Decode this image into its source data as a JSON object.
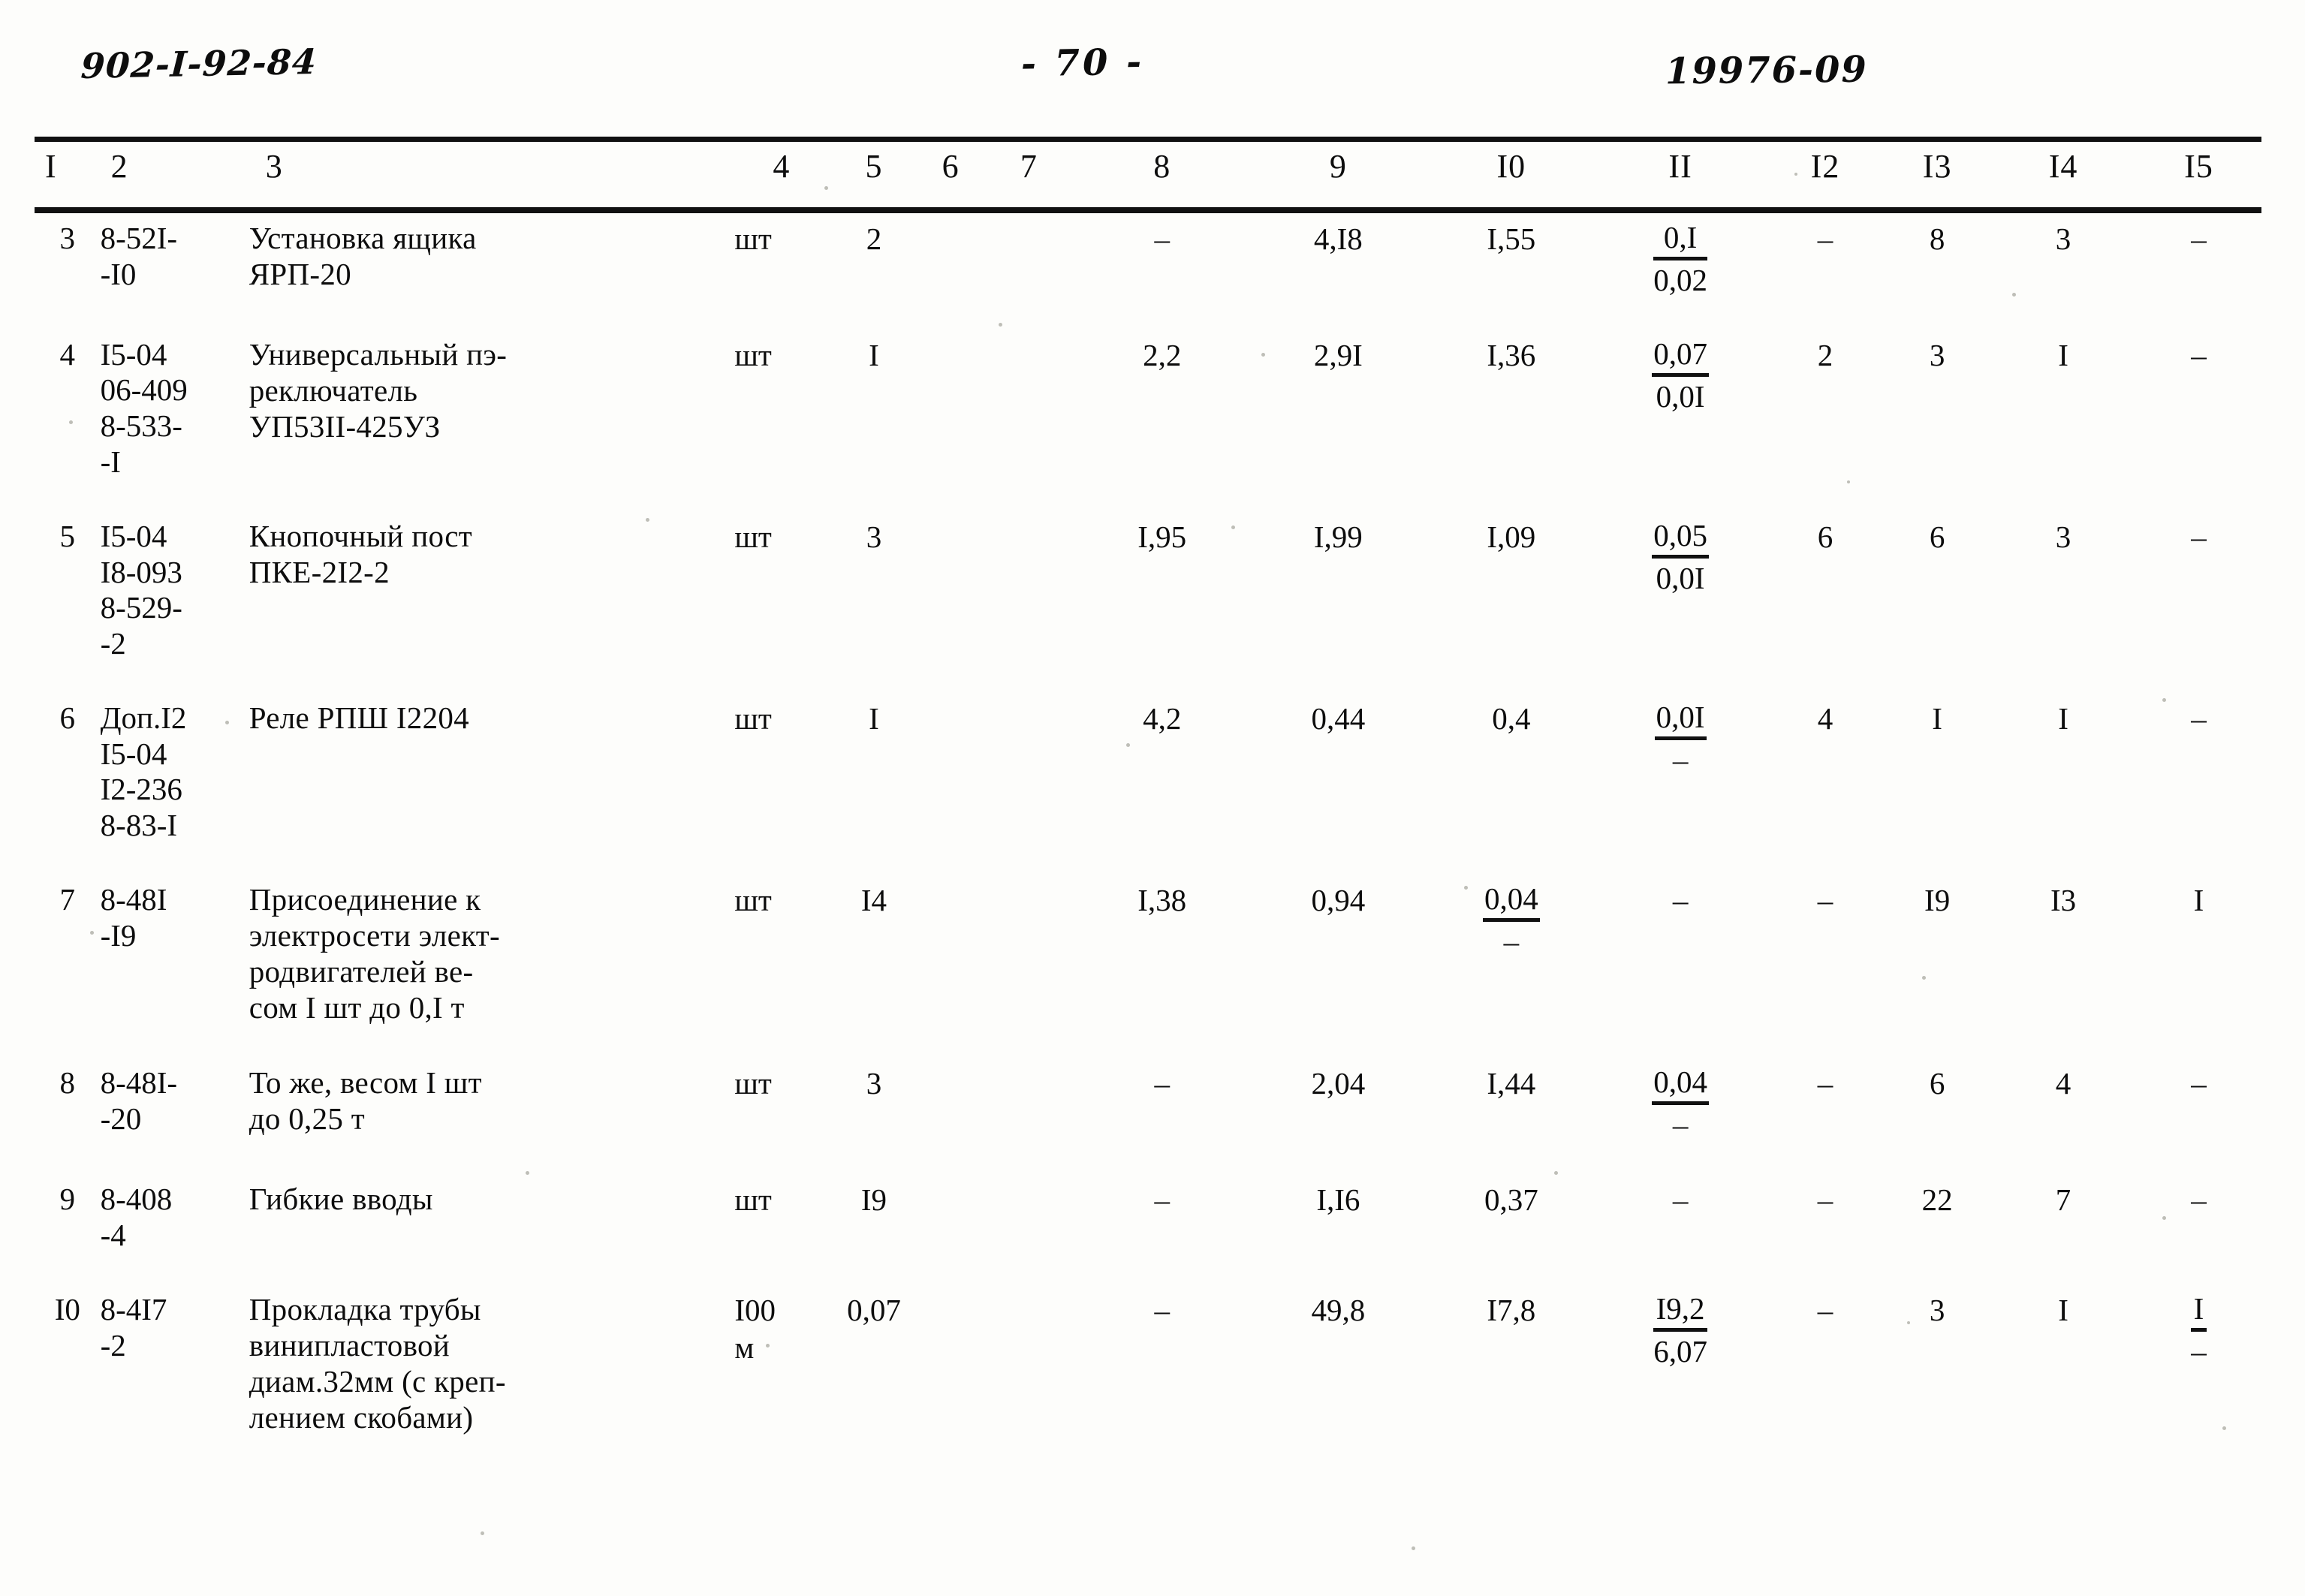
{
  "header": {
    "doc_code": "902-I-92-84",
    "page_marker": "- 70 -",
    "sheet_code": "19976-09"
  },
  "table": {
    "column_numbers": [
      "I",
      "2",
      "3",
      "4",
      "5",
      "6",
      "7",
      "8",
      "9",
      "I0",
      "II",
      "I2",
      "I3",
      "I4",
      "I5"
    ],
    "rows": [
      {
        "pos": "3",
        "code": "8-52I-\n-I0",
        "description": "Установка ящика\nЯРП-20",
        "unit": "шт",
        "c5": "2",
        "c6": "",
        "c7": "",
        "c8": "–",
        "c9": "4,I8",
        "c10": "I,55",
        "c11_num": "0,I",
        "c11_den": "0,02",
        "c12": "–",
        "c13": "8",
        "c14": "3",
        "c15": "–"
      },
      {
        "pos": "4",
        "code": "I5-04\n06-409\n8-533-\n-I",
        "description": "Универсальный пэ-\nреключатель\nУП53II-425УЗ",
        "unit": "шт",
        "c5": "I",
        "c6": "",
        "c7": "",
        "c8": "2,2",
        "c9": "2,9I",
        "c10": "I,36",
        "c11_num": "0,07",
        "c11_den": "0,0I",
        "c12": "2",
        "c13": "3",
        "c14": "I",
        "c15": "–"
      },
      {
        "pos": "5",
        "code": "I5-04\nI8-093\n8-529-\n-2",
        "description": "Кнопочный пост\nПКЕ-2I2-2",
        "unit": "шт",
        "c5": "3",
        "c6": "",
        "c7": "",
        "c8": "I,95",
        "c9": "I,99",
        "c10": "I,09",
        "c11_num": "0,05",
        "c11_den": "0,0I",
        "c12": "6",
        "c13": "6",
        "c14": "3",
        "c15": "–"
      },
      {
        "pos": "6",
        "code": "Доп.I2\nI5-04\nI2-236\n8-83-I",
        "description": "Реле РПШ I2204",
        "unit": "шт",
        "c5": "I",
        "c6": "",
        "c7": "",
        "c8": "4,2",
        "c9": "0,44",
        "c10": "0,4",
        "c11_num": "0,0I",
        "c11_den": "–",
        "c12": "4",
        "c13": "I",
        "c14": "I",
        "c15": "–"
      },
      {
        "pos": "7",
        "code": "8-48I\n-I9",
        "description": "Присоединение к\nэлектросети элект-\nродвигателей ве-\nсом I шт до 0,I т",
        "unit": "шт",
        "c5": "I4",
        "c6": "",
        "c7": "",
        "c8": "I,38",
        "c9": "0,94",
        "c10_num": "0,04",
        "c10_den": "–",
        "c11": "–",
        "c12": "–",
        "c13": "I9",
        "c14": "I3",
        "c15": "I"
      },
      {
        "pos": "8",
        "code": "8-48I-\n-20",
        "description": "То же, весом I шт\nдо 0,25 т",
        "unit": "шт",
        "c5": "3",
        "c6": "",
        "c7": "",
        "c8": "–",
        "c9": "2,04",
        "c10": "I,44",
        "c11_num": "0,04",
        "c11_den": "–",
        "c12": "–",
        "c13": "6",
        "c14": "4",
        "c15": "–"
      },
      {
        "pos": "9",
        "code": "8-408\n-4",
        "description": "Гибкие вводы",
        "unit": "шт",
        "c5": "I9",
        "c6": "",
        "c7": "",
        "c8": "–",
        "c9": "I,I6",
        "c10": "0,37",
        "c11": "–",
        "c12": "–",
        "c13": "22",
        "c14": "7",
        "c15": "–"
      },
      {
        "pos": "I0",
        "code": "8-4I7\n-2",
        "description": "Прокладка трубы\nвинипластовой\nдиам.32мм (с креп-\nлением скобами)",
        "unit": "I00\nм",
        "c5": "0,07",
        "c6": "",
        "c7": "",
        "c8": "–",
        "c9": "49,8",
        "c10": "I7,8",
        "c11_num": "I9,2",
        "c11_den": "6,07",
        "c12": "–",
        "c13": "3",
        "c14": "I",
        "c15_num": "I",
        "c15_den": "–"
      }
    ]
  }
}
